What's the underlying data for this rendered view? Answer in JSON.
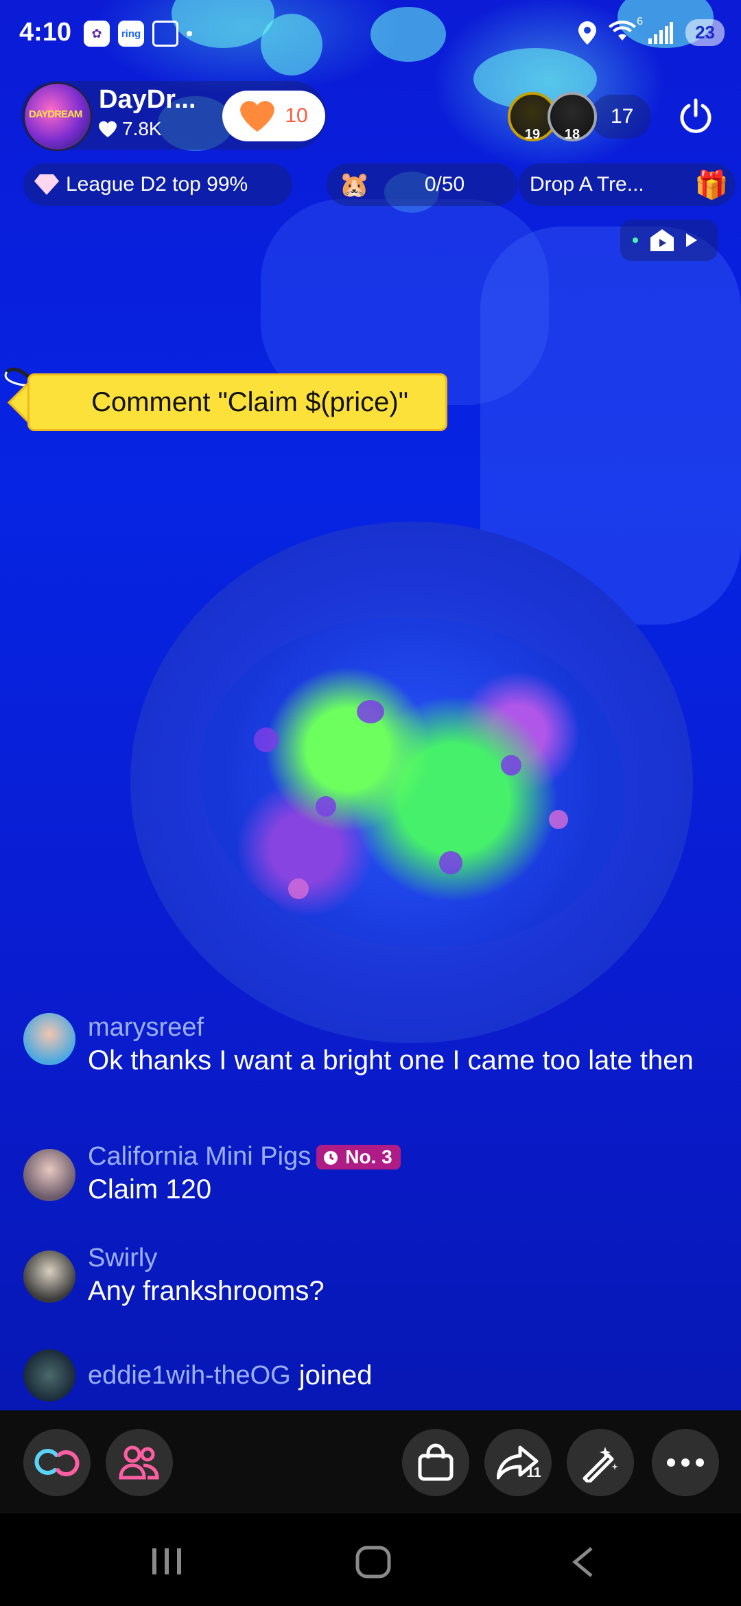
{
  "status_bar": {
    "time": "4:10",
    "app_icons": [
      "taco-bell-icon",
      "ring-icon",
      "scan-icon"
    ],
    "ring_label": "ring",
    "battery": "23",
    "wifi_badge": "6"
  },
  "host": {
    "name": "DayDr...",
    "likes": "7.8K",
    "follow_count": "10",
    "logo_text": "DAYDREAM"
  },
  "viewers": {
    "top1_rank": "19",
    "top2_rank": "18",
    "count": "17"
  },
  "pills": {
    "league": "League D2 top 99%",
    "goal": "0/50",
    "drop": "Drop A Tre..."
  },
  "claim_tag": "Comment \"Claim $(price)\"",
  "comments": [
    {
      "name": "marysreef",
      "text": "Ok thanks I want a bright one I came too late then"
    },
    {
      "name": "California Mini Pigs",
      "badge": "No. 3",
      "text": "Claim 120"
    },
    {
      "name": "Swirly",
      "text": "Any frankshrooms?"
    },
    {
      "name": "eddie1wih-theOG",
      "text": "joined"
    }
  ],
  "bottom_bar": {
    "share_count": "11"
  },
  "colors": {
    "accent_pink": "#ff5fa2",
    "follow_orange": "#ff8a3c",
    "tag_yellow": "#fde13b",
    "badge_magenta": "#b01c86"
  }
}
